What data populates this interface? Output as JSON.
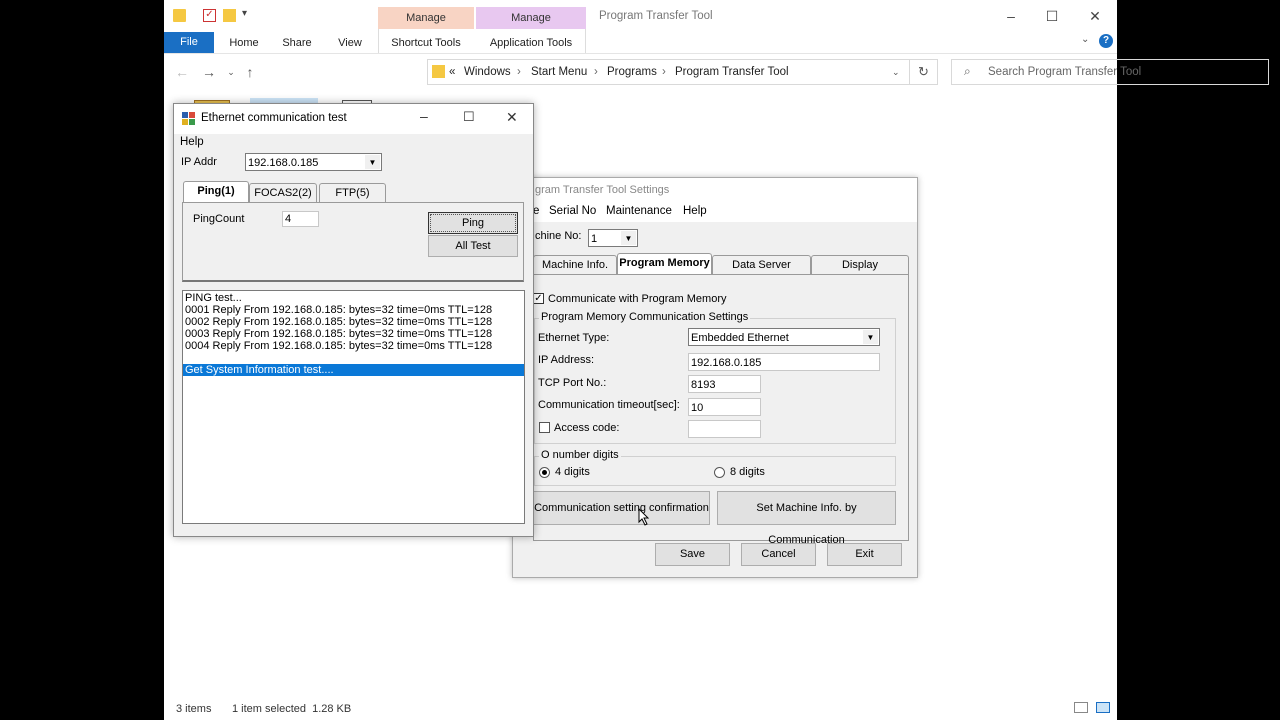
{
  "explorer": {
    "title": "Program Transfer Tool",
    "context_tabs": [
      {
        "group": "Manage",
        "label": "Shortcut Tools",
        "color": "#f8d4c4"
      },
      {
        "group": "Manage",
        "label": "Application Tools",
        "color": "#e8c8f0"
      }
    ],
    "ribbon_tabs": [
      "File",
      "Home",
      "Share",
      "View"
    ],
    "breadcrumb": [
      "Windows",
      "Start Menu",
      "Programs",
      "Program Transfer Tool"
    ],
    "search_placeholder": "Search Program Transfer Tool",
    "status": {
      "items": "3 items",
      "selected": "1 item selected  1.28 KB"
    },
    "accent": "#1a6fc4"
  },
  "eth_test": {
    "title": "Ethernet communication test",
    "menu_help": "Help",
    "ip_label": "IP Addr",
    "ip_value": "192.168.0.185",
    "tabs": [
      "Ping(1)",
      "FOCAS2(2)",
      "FTP(5)"
    ],
    "ping_count_label": "PingCount",
    "ping_count_value": "4",
    "ping_button": "Ping",
    "all_test_button": "All Test",
    "log": [
      "PING test...",
      "0001 Reply From 192.168.0.185: bytes=32 time=0ms TTL=128",
      "0002 Reply From 192.168.0.185: bytes=32 time=0ms TTL=128",
      "0003 Reply From 192.168.0.185: bytes=32 time=0ms TTL=128",
      "0004 Reply From 192.168.0.185: bytes=32 time=0ms TTL=128",
      "",
      "Get System Information test...."
    ]
  },
  "settings": {
    "title": "gram Transfer Tool Settings",
    "menu": [
      "e",
      "Serial No",
      "Maintenance",
      "Help"
    ],
    "machine_no_label": "chine No:",
    "machine_no_value": "1",
    "tabs": [
      "Machine Info.",
      "Program Memory",
      "Data Server",
      "Display"
    ],
    "communicate_label": "Communicate with Program Memory",
    "group_title": "Program Memory Communication Settings",
    "ethernet_type_label": "Ethernet Type:",
    "ethernet_type_value": "Embedded Ethernet",
    "ip_label": "IP Address:",
    "ip_value": "192.168.0.185",
    "port_label": "TCP Port No.:",
    "port_value": "8193",
    "timeout_label": "Communication timeout[sec]:",
    "timeout_value": "10",
    "access_label": "Access code:",
    "access_value": "",
    "digits_title": "O number digits",
    "digits_4": "4 digits",
    "digits_8": "8 digits",
    "confirm_button": "Communication setting confirmation",
    "set_machine_button": "Set Machine Info. by Communication",
    "save": "Save",
    "cancel": "Cancel",
    "exit": "Exit"
  }
}
